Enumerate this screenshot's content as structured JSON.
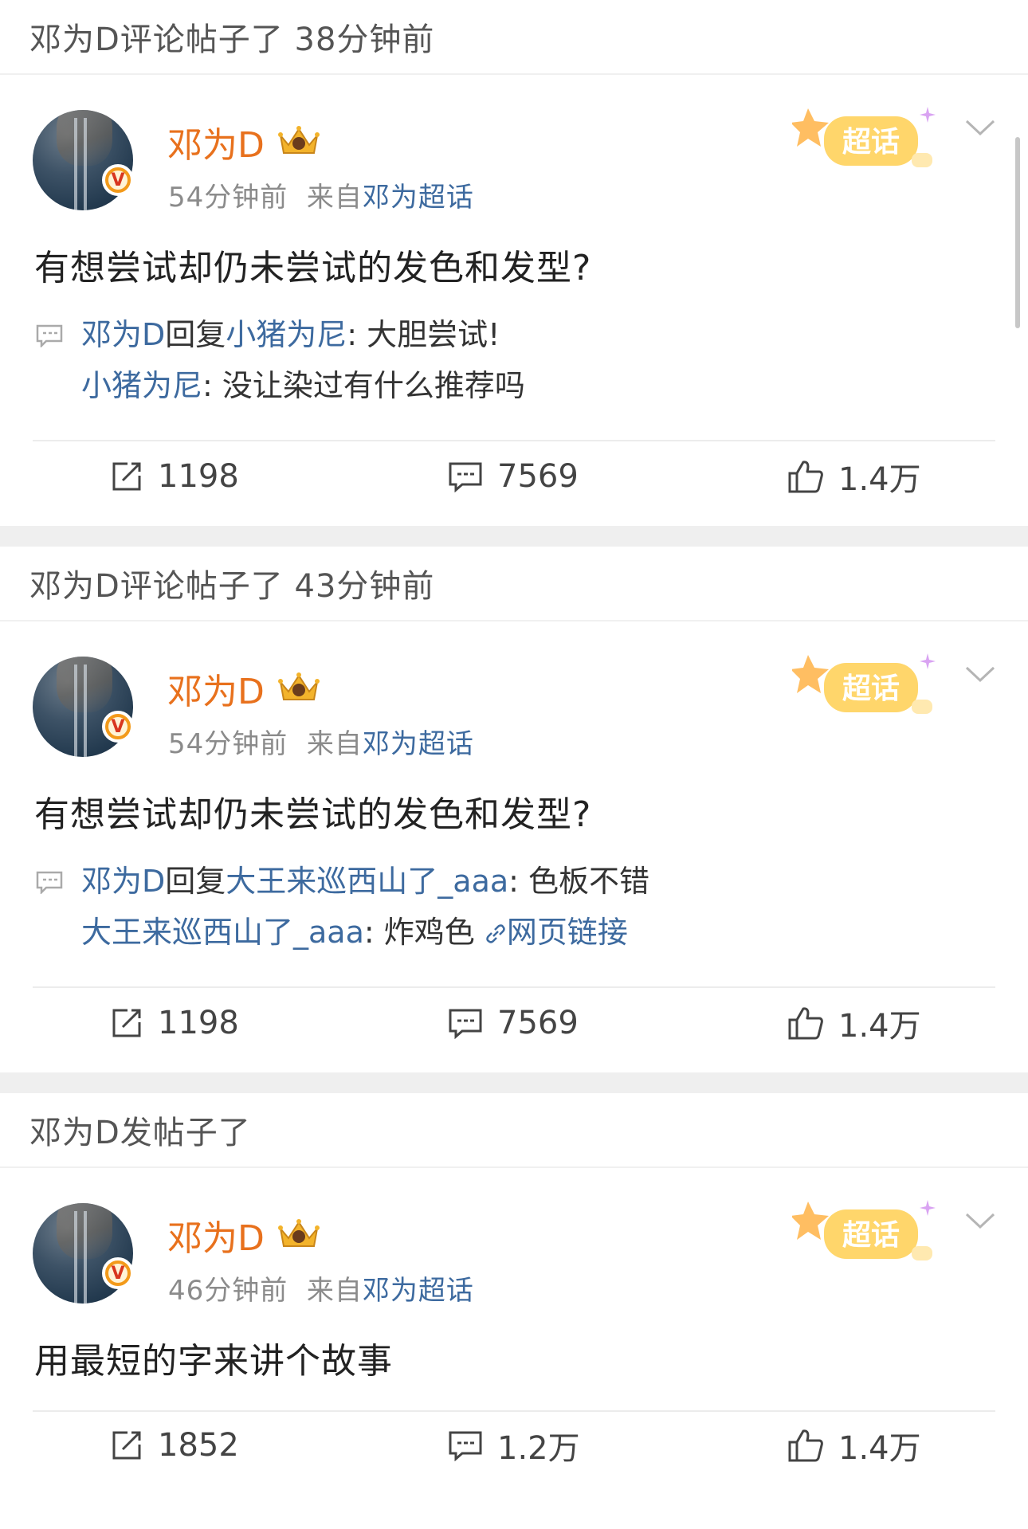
{
  "posts": [
    {
      "header": "邓为D评论帖子了 38分钟前",
      "name": "邓为D",
      "time": "54分钟前",
      "from_prefix": "来自",
      "from_source": "邓为超话",
      "text": "有想尝试却仍未尝试的发色和发型?",
      "reply_line1": {
        "user": "邓为D",
        "mid": "回复",
        "target": "小猪为尼",
        "body": ": 大胆尝试!"
      },
      "reply_line2": {
        "user": "小猪为尼",
        "body": ": 没让染过有什么推荐吗",
        "link": ""
      },
      "repost": "1198",
      "comments": "7569",
      "likes": "1.4万"
    },
    {
      "header": "邓为D评论帖子了 43分钟前",
      "name": "邓为D",
      "time": "54分钟前",
      "from_prefix": "来自",
      "from_source": "邓为超话",
      "text": "有想尝试却仍未尝试的发色和发型?",
      "reply_line1": {
        "user": "邓为D",
        "mid": "回复",
        "target": "大王来巡西山了_aaa",
        "body": ": 色板不错"
      },
      "reply_line2": {
        "user": "大王来巡西山了_aaa",
        "body": ": 炸鸡色",
        "link": "网页链接"
      },
      "repost": "1198",
      "comments": "7569",
      "likes": "1.4万"
    },
    {
      "header": "邓为D发帖子了",
      "name": "邓为D",
      "time": "46分钟前",
      "from_prefix": "来自",
      "from_source": "邓为超话",
      "text": "用最短的字来讲个故事",
      "repost": "1852",
      "comments": "1.2万",
      "likes": "1.4万"
    }
  ],
  "badge": {
    "chaohua_label": "超话",
    "vip_letter": "V"
  },
  "icons": [
    "repost-icon",
    "comment-icon",
    "like-icon",
    "chevron-down-icon",
    "reply-bubble-icon",
    "link-icon",
    "crown-icon",
    "chaohua-badge"
  ]
}
